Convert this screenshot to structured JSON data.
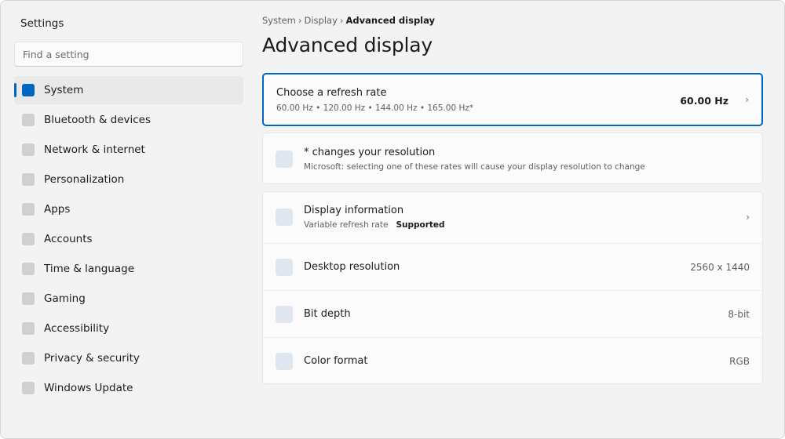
{
  "app": {
    "title": "Settings"
  },
  "search": {
    "placeholder": "Find a setting"
  },
  "sidebar": {
    "items": [
      {
        "label": "System",
        "active": true
      },
      {
        "label": "Bluetooth & devices"
      },
      {
        "label": "Network & internet"
      },
      {
        "label": "Personalization"
      },
      {
        "label": "Apps"
      },
      {
        "label": "Accounts"
      },
      {
        "label": "Time & language"
      },
      {
        "label": "Gaming"
      },
      {
        "label": "Accessibility"
      },
      {
        "label": "Privacy & security"
      },
      {
        "label": "Windows Update"
      }
    ]
  },
  "breadcrumb": {
    "items": [
      "System",
      "Display"
    ],
    "current": "Advanced display",
    "separator": "›"
  },
  "page": {
    "title": "Advanced display"
  },
  "refresh": {
    "title": "Choose a refresh rate",
    "options_text": "60.00 Hz  •  120.00 Hz  •  144.00 Hz  •  165.00 Hz*",
    "value": "60.00 Hz",
    "chevron": "›"
  },
  "note": {
    "title": "* changes your resolution",
    "subtitle": "Microsoft: selecting one of these rates will cause your display resolution to change"
  },
  "info": {
    "display": {
      "title": "Display information",
      "sub_label": "Variable refresh rate",
      "sub_value": "Supported",
      "chevron": "›"
    },
    "resolution": {
      "title": "Desktop resolution",
      "value": "2560 x 1440"
    },
    "bit_depth": {
      "title": "Bit depth",
      "value": "8-bit"
    },
    "color_format": {
      "title": "Color format",
      "value": "RGB"
    }
  },
  "colors": {
    "accent": "#0067c0",
    "background": "#f3f3f3",
    "card": "#fbfbfb"
  }
}
